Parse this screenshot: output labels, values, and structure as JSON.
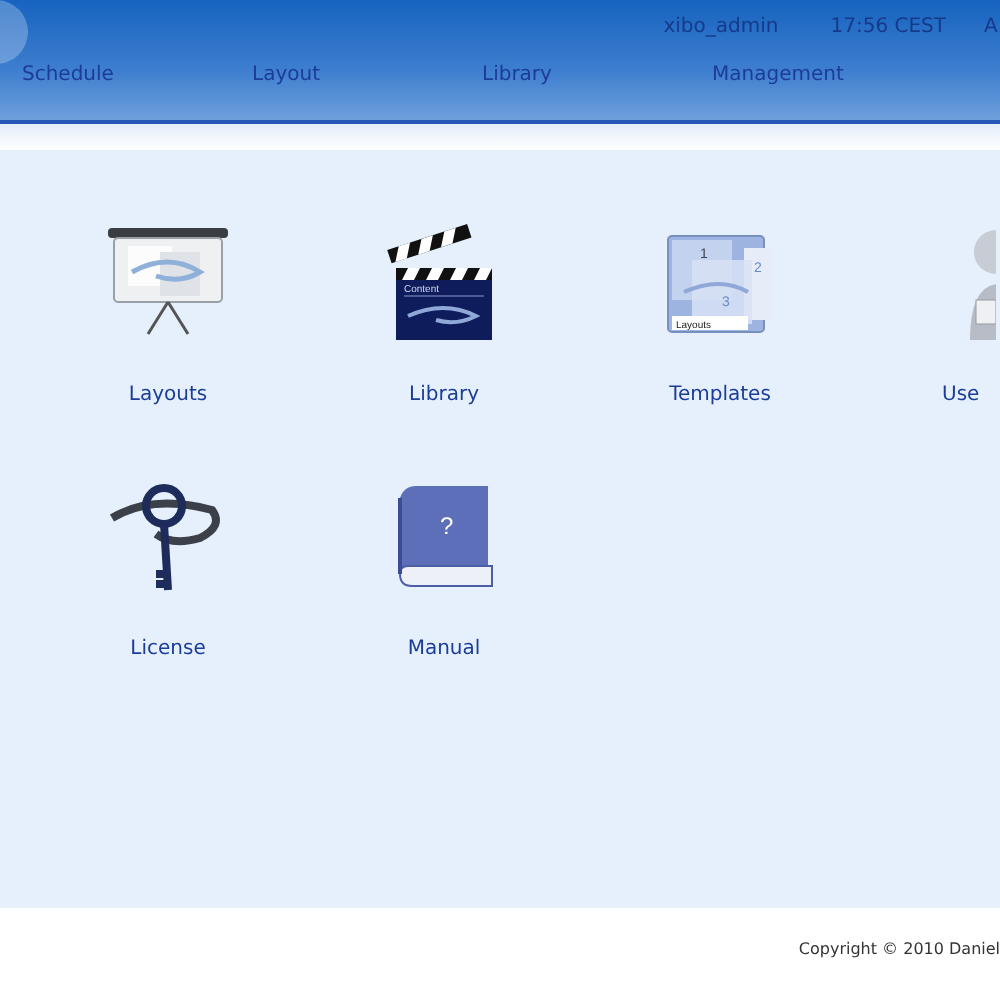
{
  "header": {
    "user": "xibo_admin",
    "time": "17:56 CEST",
    "cut_link": "A"
  },
  "nav": [
    {
      "label": "Schedule"
    },
    {
      "label": "Layout"
    },
    {
      "label": "Library"
    },
    {
      "label": "Management"
    }
  ],
  "tiles": [
    {
      "kind": "projector",
      "label": "Layouts"
    },
    {
      "kind": "clapper",
      "label": "Library",
      "caption": "Content"
    },
    {
      "kind": "templates",
      "label": "Templates",
      "caption": "Layouts",
      "numbers": [
        "1",
        "2",
        "3"
      ]
    },
    {
      "kind": "user",
      "label": "Use"
    },
    {
      "kind": "key",
      "label": "License"
    },
    {
      "kind": "book",
      "label": "Manual",
      "caption": "?"
    }
  ],
  "footer": {
    "copyright": "Copyright © 2010 Daniel"
  }
}
